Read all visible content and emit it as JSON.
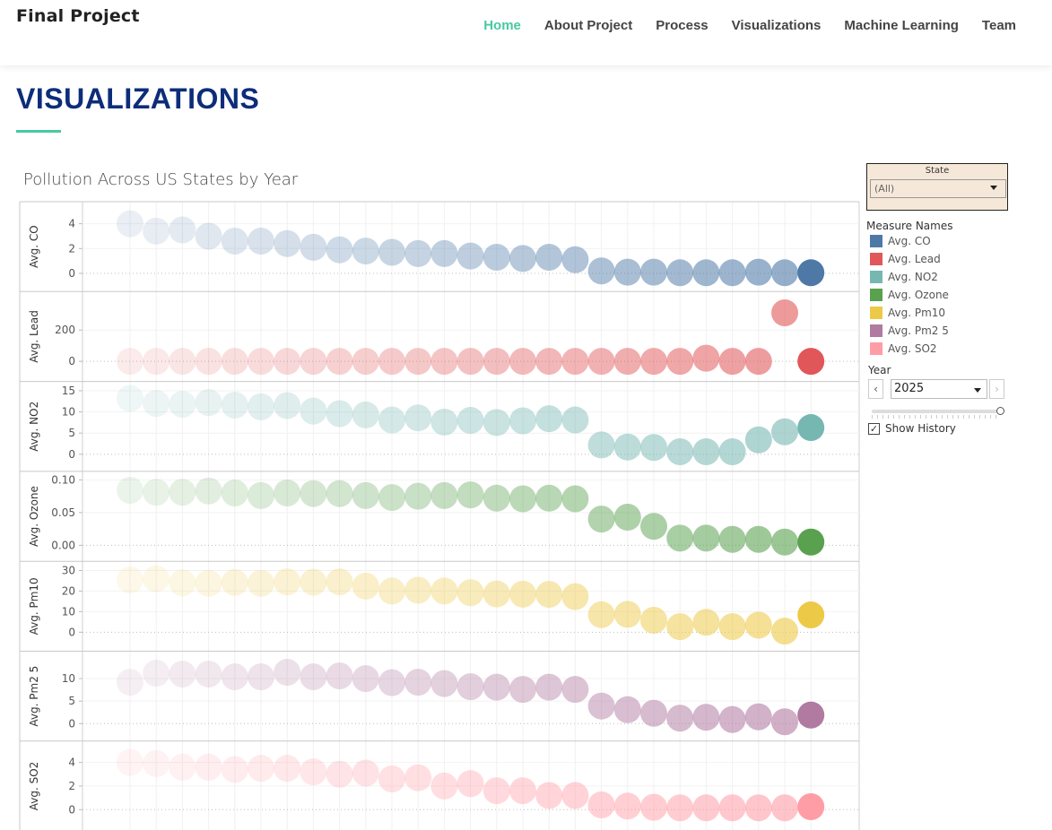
{
  "brand": "Final Project",
  "nav": [
    {
      "label": "Home",
      "active": true
    },
    {
      "label": "About Project",
      "active": false
    },
    {
      "label": "Process",
      "active": false
    },
    {
      "label": "Visualizations",
      "active": false
    },
    {
      "label": "Machine Learning",
      "active": false
    },
    {
      "label": "Team",
      "active": false
    }
  ],
  "page_title": "VISUALIZATIONS",
  "accent_color": "#47c9a2",
  "title_color": "#0d2d7a",
  "filter": {
    "label": "State",
    "value": "(All)"
  },
  "legend": {
    "title": "Measure Names",
    "items": [
      {
        "label": "Avg. CO",
        "color": "#4e79a7"
      },
      {
        "label": "Avg. Lead",
        "color": "#e15759"
      },
      {
        "label": "Avg. NO2",
        "color": "#76b7b2"
      },
      {
        "label": "Avg. Ozone",
        "color": "#59a14f"
      },
      {
        "label": "Avg. Pm10",
        "color": "#edc948"
      },
      {
        "label": "Avg. Pm2 5",
        "color": "#b07aa1"
      },
      {
        "label": "Avg. SO2",
        "color": "#ff9da7"
      }
    ]
  },
  "year": {
    "label": "Year",
    "value": "2025",
    "prev": "‹",
    "next": "›"
  },
  "show_history": {
    "label": "Show History",
    "checked": true,
    "check": "✓"
  },
  "chart_data": {
    "type": "scatter",
    "title": "Pollution Across US States by Year",
    "series": [
      {
        "name": "Avg. CO",
        "color": "#4e79a7",
        "ticks": [
          "0",
          "2",
          "4"
        ],
        "ylim": [
          -0.6,
          5.2
        ],
        "values": [
          4.0,
          3.4,
          3.5,
          3.0,
          2.6,
          2.6,
          2.4,
          2.1,
          1.9,
          1.8,
          1.7,
          1.6,
          1.6,
          1.4,
          1.3,
          1.2,
          1.3,
          1.1,
          0.2,
          0.1,
          0.1,
          0.05,
          0.05,
          0.05,
          0.1,
          0.05,
          0.05
        ]
      },
      {
        "name": "Avg. Lead",
        "color": "#e15759",
        "ticks": [
          "0",
          "200"
        ],
        "ylim": [
          -60,
          400
        ],
        "values": [
          0,
          0,
          0,
          0,
          0,
          0,
          0,
          0,
          0,
          0,
          0,
          0,
          0,
          0,
          0,
          0,
          0,
          0,
          0,
          0,
          0,
          0,
          20,
          0,
          0,
          310,
          0
        ]
      },
      {
        "name": "Avg. NO2",
        "color": "#76b7b2",
        "ticks": [
          "0",
          "5",
          "10",
          "15"
        ],
        "ylim": [
          -1.5,
          15.5
        ],
        "values": [
          13.2,
          12.0,
          11.8,
          12.2,
          11.6,
          11.2,
          11.5,
          10.2,
          9.6,
          9.3,
          8.1,
          8.6,
          7.6,
          8.0,
          7.5,
          7.9,
          8.4,
          8.1,
          2.2,
          1.7,
          1.6,
          0.6,
          0.6,
          0.6,
          3.4,
          5.3,
          6.3
        ]
      },
      {
        "name": "Avg. Ozone",
        "color": "#59a14f",
        "ticks": [
          "0.00",
          "0.05",
          "0.10"
        ],
        "ylim": [
          -0.008,
          0.102
        ],
        "values": [
          0.084,
          0.081,
          0.081,
          0.083,
          0.08,
          0.076,
          0.08,
          0.079,
          0.079,
          0.076,
          0.073,
          0.075,
          0.076,
          0.077,
          0.072,
          0.071,
          0.072,
          0.071,
          0.04,
          0.043,
          0.029,
          0.011,
          0.011,
          0.009,
          0.009,
          0.005,
          0.005
        ]
      },
      {
        "name": "Avg. Pm10",
        "color": "#edc948",
        "ticks": [
          "0",
          "10",
          "20",
          "30"
        ],
        "ylim": [
          -4,
          31
        ],
        "values": [
          25.4,
          26.0,
          24.0,
          23.8,
          24.2,
          23.8,
          24.5,
          24.3,
          24.5,
          22.4,
          20.0,
          20.4,
          20.0,
          19.2,
          18.6,
          18.5,
          18.4,
          17.3,
          8.5,
          8.7,
          5.8,
          2.7,
          4.8,
          2.7,
          3.4,
          0.5,
          8.4
        ]
      },
      {
        "name": "Avg. Pm2 5",
        "color": "#b07aa1",
        "ticks": [
          "0",
          "5",
          "10"
        ],
        "ylim": [
          -1.5,
          14.5
        ],
        "values": [
          9.2,
          11.2,
          11.0,
          11.0,
          10.4,
          10.4,
          11.4,
          10.4,
          10.6,
          10.0,
          9.1,
          9.2,
          8.9,
          8.2,
          8.1,
          7.6,
          8.1,
          7.6,
          3.9,
          3.1,
          2.3,
          1.2,
          1.4,
          0.9,
          1.5,
          0.4,
          1.9
        ]
      },
      {
        "name": "Avg. SO2",
        "color": "#ff9da7",
        "ticks": [
          "0",
          "2",
          "4"
        ],
        "ylim": [
          -0.9,
          5.2
        ],
        "values": [
          4.0,
          3.9,
          3.6,
          3.6,
          3.4,
          3.5,
          3.5,
          3.2,
          3.0,
          3.1,
          2.6,
          2.7,
          2.0,
          2.2,
          1.6,
          1.6,
          1.2,
          1.2,
          0.4,
          0.3,
          0.2,
          0.15,
          0.15,
          0.15,
          0.15,
          0.15,
          0.25
        ]
      }
    ]
  }
}
